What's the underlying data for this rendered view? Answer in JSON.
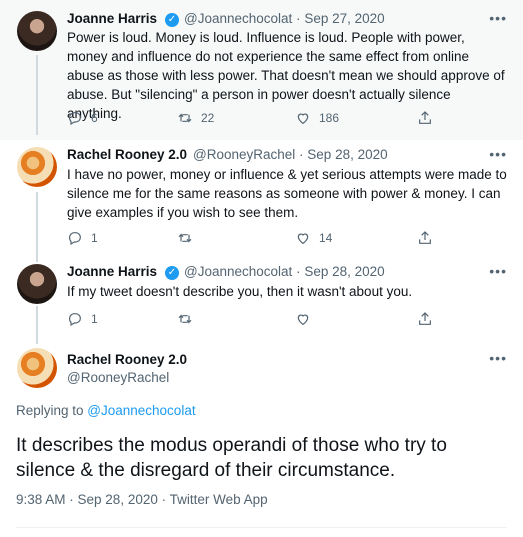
{
  "tweets": [
    {
      "name": "Joanne Harris",
      "handle": "@Joannechocolat",
      "dot": "·",
      "date": "Sep 27, 2020",
      "text": "Power is loud. Money is loud. Influence is loud. People with power, money and influence do not experience the same effect from online abuse as those with less power. That doesn't mean we should approve of abuse. But \"silencing\" a person in power doesn't actually silence anything.",
      "replies": "6",
      "retweets": "22",
      "likes": "186"
    },
    {
      "name": "Rachel Rooney 2.0",
      "handle": "@RooneyRachel",
      "dot": "·",
      "date": "Sep 28, 2020",
      "text": "I have no power, money or influence & yet serious attempts were made to silence me for the same reasons as someone with power & money. I can give examples if you wish to see them.",
      "replies": "1",
      "retweets": "",
      "likes": "14"
    },
    {
      "name": "Joanne Harris",
      "handle": "@Joannechocolat",
      "dot": "·",
      "date": "Sep 28, 2020",
      "text": "If my tweet doesn't describe you, then it wasn't about you.",
      "replies": "1",
      "retweets": "",
      "likes": ""
    }
  ],
  "focused": {
    "name": "Rachel Rooney 2.0",
    "handle": "@RooneyRachel",
    "replying_prefix": "Replying to ",
    "replying_to": "@Joannechocolat",
    "text": "It describes the modus operandi of those who try to silence & the disregard of their circumstance.",
    "meta": "9:38 AM · Sep 28, 2020 · Twitter Web App"
  },
  "more_glyph": "•••",
  "verified_glyph": "✓",
  "icons": [
    "reply-icon",
    "retweet-icon",
    "like-icon",
    "share-icon",
    "verified-badge-icon",
    "more-icon"
  ],
  "colors": {
    "accent": "#1d9bf0",
    "secondary_text": "#536471",
    "thread_line": "#cfd9de",
    "highlight_bg": "#f7f9f9"
  }
}
